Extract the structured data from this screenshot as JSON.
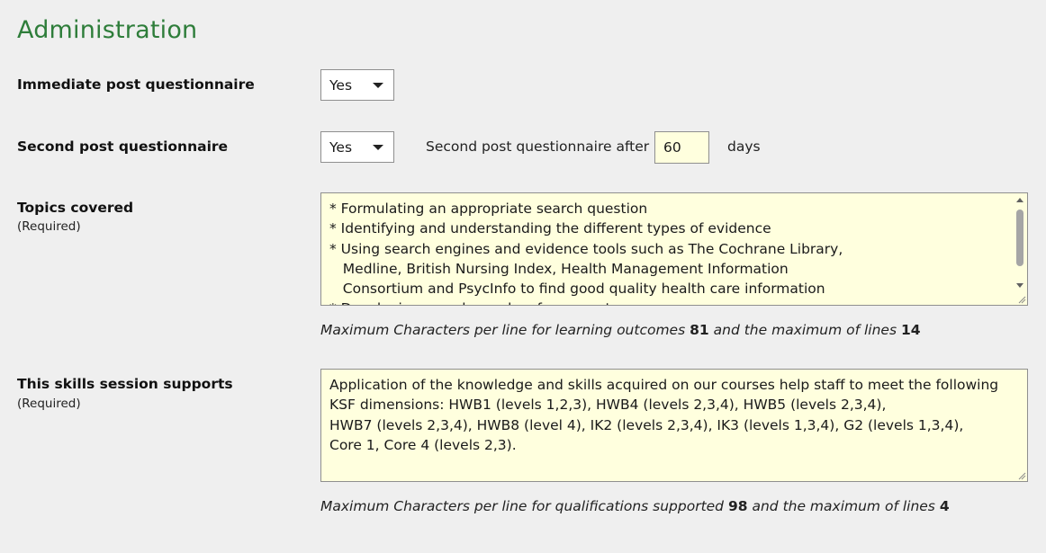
{
  "section": {
    "title": "Administration"
  },
  "immediate_post": {
    "label": "Immediate post questionnaire",
    "value": "Yes"
  },
  "second_post": {
    "label": "Second post questionnaire",
    "value": "Yes",
    "after_label": "Second post questionnaire after",
    "days_value": "60",
    "days_unit": "days"
  },
  "topics": {
    "label": "Topics covered",
    "required": "(Required)",
    "text": "* Formulating an appropriate search question\n* Identifying and understanding the different types of evidence\n* Using search engines and evidence tools such as The Cochrane Library,\n   Medline, British Nursing Index, Health Management Information\n   Consortium and PsycInfo to find good quality health care information\n* Developing saved searches for current awareness",
    "hint_prefix": "Maximum Characters per line for learning outcomes",
    "max_chars": "81",
    "hint_middle": "and the maximum of lines",
    "max_lines": "14"
  },
  "skills": {
    "label": "This skills session supports",
    "required": "(Required)",
    "text": "Application of the knowledge and skills acquired on our courses help staff to meet the following\nKSF dimensions: HWB1 (levels 1,2,3), HWB4 (levels 2,3,4), HWB5 (levels 2,3,4),\nHWB7 (levels 2,3,4), HWB8 (level 4), IK2 (levels 2,3,4), IK3 (levels 1,3,4), G2 (levels 1,3,4),\nCore 1, Core 4 (levels 2,3).",
    "hint_prefix": "Maximum Characters per line for qualifications supported",
    "max_chars": "98",
    "hint_middle": "and the maximum of lines",
    "max_lines": "4"
  }
}
